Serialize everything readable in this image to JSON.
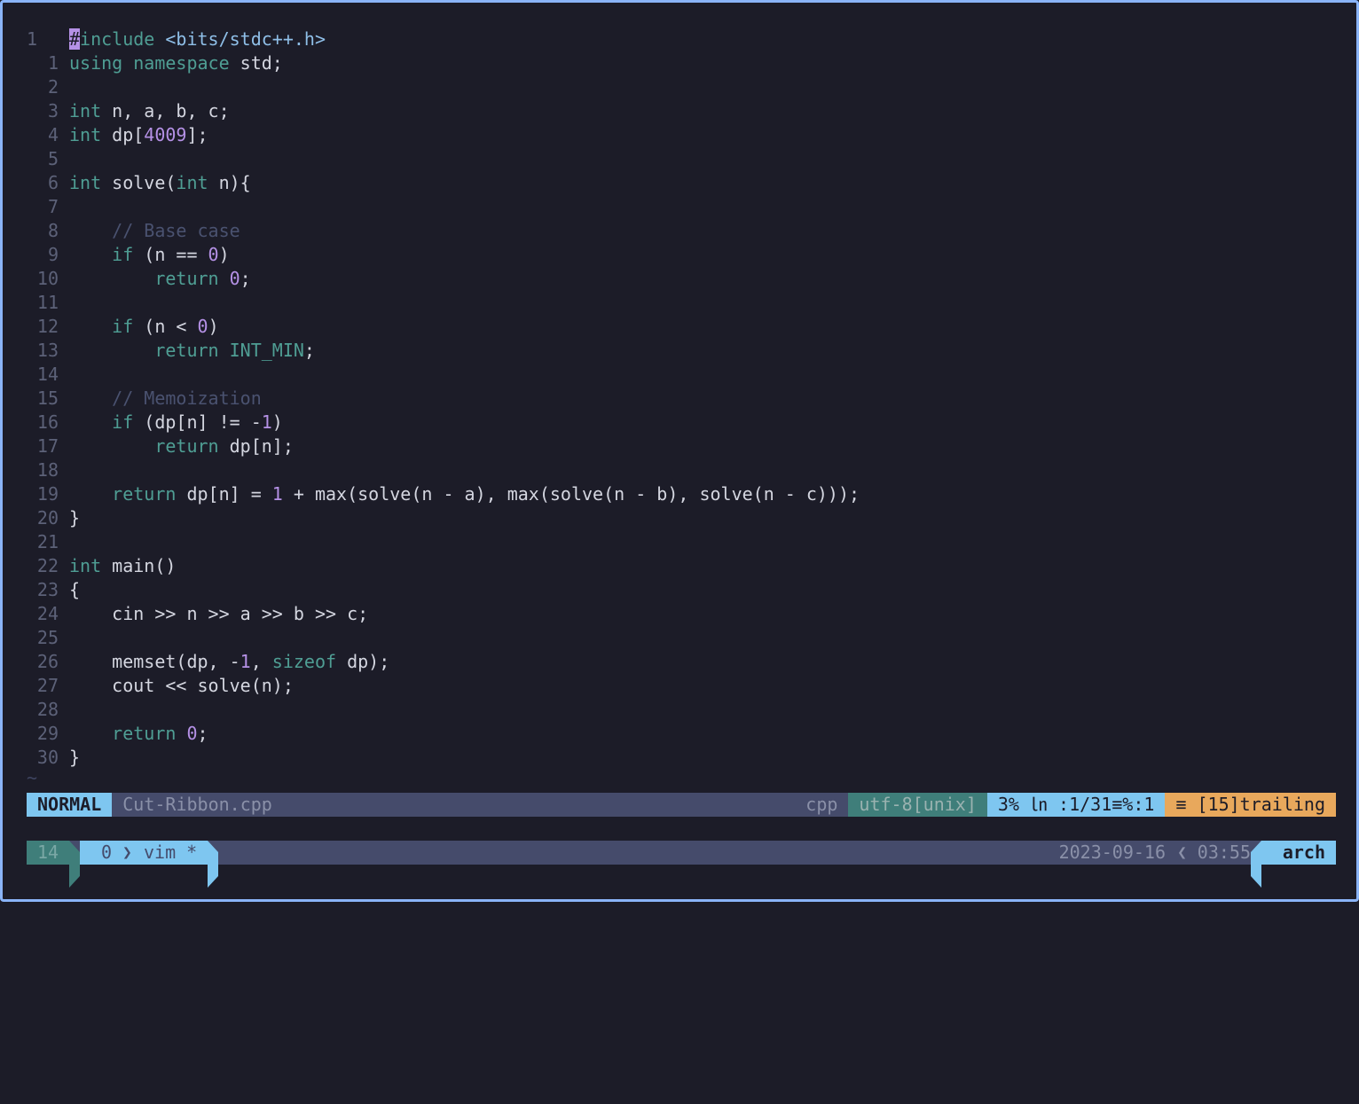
{
  "editor": {
    "lines": [
      {
        "num": "1",
        "abs": true,
        "segs": [
          {
            "c": "cursor",
            "t": "#"
          },
          {
            "c": "kw",
            "t": "include "
          },
          {
            "c": "str",
            "t": "<bits/stdc++.h>"
          }
        ]
      },
      {
        "num": "1",
        "segs": [
          {
            "c": "kw",
            "t": "using namespace "
          },
          {
            "c": "",
            "t": "std;"
          }
        ]
      },
      {
        "num": "2",
        "segs": []
      },
      {
        "num": "3",
        "segs": [
          {
            "c": "kw",
            "t": "int "
          },
          {
            "c": "",
            "t": "n, a, b, c;"
          }
        ]
      },
      {
        "num": "4",
        "segs": [
          {
            "c": "kw",
            "t": "int "
          },
          {
            "c": "",
            "t": "dp["
          },
          {
            "c": "num",
            "t": "4009"
          },
          {
            "c": "",
            "t": "];"
          }
        ]
      },
      {
        "num": "5",
        "segs": []
      },
      {
        "num": "6",
        "segs": [
          {
            "c": "kw",
            "t": "int "
          },
          {
            "c": "",
            "t": "solve("
          },
          {
            "c": "kw",
            "t": "int "
          },
          {
            "c": "",
            "t": "n){"
          }
        ]
      },
      {
        "num": "7",
        "segs": []
      },
      {
        "num": "8",
        "segs": [
          {
            "c": "",
            "t": "    "
          },
          {
            "c": "cmt",
            "t": "// Base case"
          }
        ]
      },
      {
        "num": "9",
        "segs": [
          {
            "c": "",
            "t": "    "
          },
          {
            "c": "kw",
            "t": "if "
          },
          {
            "c": "",
            "t": "(n == "
          },
          {
            "c": "num",
            "t": "0"
          },
          {
            "c": "",
            "t": ")"
          }
        ]
      },
      {
        "num": "10",
        "segs": [
          {
            "c": "",
            "t": "        "
          },
          {
            "c": "kw",
            "t": "return "
          },
          {
            "c": "num",
            "t": "0"
          },
          {
            "c": "",
            "t": ";"
          }
        ]
      },
      {
        "num": "11",
        "segs": []
      },
      {
        "num": "12",
        "segs": [
          {
            "c": "",
            "t": "    "
          },
          {
            "c": "kw",
            "t": "if "
          },
          {
            "c": "",
            "t": "(n < "
          },
          {
            "c": "num",
            "t": "0"
          },
          {
            "c": "",
            "t": ")"
          }
        ]
      },
      {
        "num": "13",
        "segs": [
          {
            "c": "",
            "t": "        "
          },
          {
            "c": "kw",
            "t": "return INT_MIN"
          },
          {
            "c": "",
            "t": ";"
          }
        ]
      },
      {
        "num": "14",
        "segs": []
      },
      {
        "num": "15",
        "segs": [
          {
            "c": "",
            "t": "    "
          },
          {
            "c": "cmt",
            "t": "// Memoization"
          }
        ]
      },
      {
        "num": "16",
        "segs": [
          {
            "c": "",
            "t": "    "
          },
          {
            "c": "kw",
            "t": "if "
          },
          {
            "c": "",
            "t": "(dp[n] != -"
          },
          {
            "c": "num",
            "t": "1"
          },
          {
            "c": "",
            "t": ")"
          }
        ]
      },
      {
        "num": "17",
        "segs": [
          {
            "c": "",
            "t": "        "
          },
          {
            "c": "kw",
            "t": "return "
          },
          {
            "c": "",
            "t": "dp[n];"
          }
        ]
      },
      {
        "num": "18",
        "segs": []
      },
      {
        "num": "19",
        "segs": [
          {
            "c": "",
            "t": "    "
          },
          {
            "c": "kw",
            "t": "return "
          },
          {
            "c": "",
            "t": "dp[n] = "
          },
          {
            "c": "num",
            "t": "1"
          },
          {
            "c": "",
            "t": " + max(solve(n - a), max(solve(n - b), solve(n - c)));"
          }
        ]
      },
      {
        "num": "20",
        "segs": [
          {
            "c": "",
            "t": "}"
          }
        ]
      },
      {
        "num": "21",
        "segs": []
      },
      {
        "num": "22",
        "segs": [
          {
            "c": "kw",
            "t": "int "
          },
          {
            "c": "",
            "t": "main()"
          }
        ]
      },
      {
        "num": "23",
        "segs": [
          {
            "c": "",
            "t": "{"
          }
        ]
      },
      {
        "num": "24",
        "segs": [
          {
            "c": "",
            "t": "    cin >> n >> a >> b >> c;"
          }
        ]
      },
      {
        "num": "25",
        "segs": []
      },
      {
        "num": "26",
        "segs": [
          {
            "c": "",
            "t": "    memset(dp, -"
          },
          {
            "c": "num",
            "t": "1"
          },
          {
            "c": "",
            "t": ", "
          },
          {
            "c": "kw",
            "t": "sizeof "
          },
          {
            "c": "",
            "t": "dp);"
          }
        ]
      },
      {
        "num": "27",
        "segs": [
          {
            "c": "",
            "t": "    cout << solve(n);"
          }
        ]
      },
      {
        "num": "28",
        "segs": []
      },
      {
        "num": "29",
        "segs": [
          {
            "c": "",
            "t": "    "
          },
          {
            "c": "kw",
            "t": "return "
          },
          {
            "c": "num",
            "t": "0"
          },
          {
            "c": "",
            "t": ";"
          }
        ]
      },
      {
        "num": "30",
        "segs": [
          {
            "c": "",
            "t": "}"
          }
        ]
      }
    ],
    "tilde": "~"
  },
  "statusline": {
    "mode": "NORMAL",
    "filename": "Cut-Ribbon.cpp",
    "filetype": "cpp",
    "encoding": "utf-8[unix]",
    "position": "3% ㏑ :1/31≡%:1",
    "warning": "≡ [15]trailing"
  },
  "tmux": {
    "session": "14",
    "window_index": "0",
    "separator": "❯",
    "window_name": "vim *",
    "date": "2023-09-16",
    "separator2": "❮",
    "time": "03:55",
    "host": "arch"
  }
}
